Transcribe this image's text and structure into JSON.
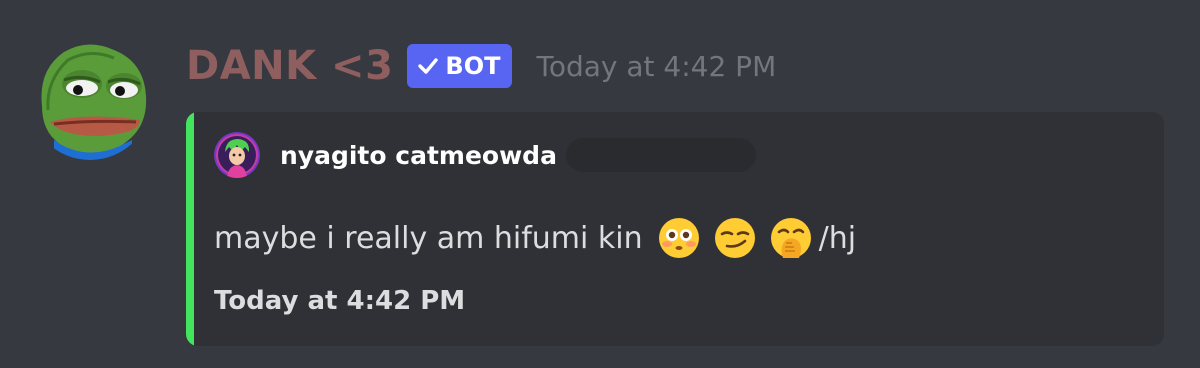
{
  "message": {
    "author": {
      "username": "DANK <3",
      "badge": "BOT",
      "avatar_icon": "pepe-frog-icon"
    },
    "timestamp": "Today at 4:42 PM",
    "embed": {
      "accent_color": "#43e55d",
      "author_name": "nyagito catmeowda",
      "author_avatar_icon": "anime-avatar-icon",
      "description": {
        "text": "maybe i really am hifumi kin",
        "emojis": [
          "flushed-face-icon",
          "smirking-face-icon",
          "face-with-hand-over-mouth-icon"
        ],
        "suffix": "/hj"
      },
      "footer": "Today at 4:42 PM"
    }
  },
  "colors": {
    "background": "#36393f",
    "embed_background": "#2f3136",
    "username": "#8f5f60",
    "bot_badge": "#5865f2"
  }
}
